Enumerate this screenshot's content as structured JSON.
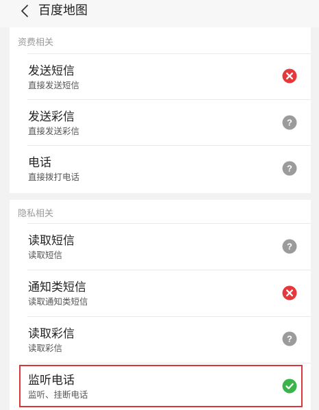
{
  "header": {
    "title": "百度地图"
  },
  "sections": [
    {
      "label": "资费相关",
      "items": [
        {
          "title": "发送短信",
          "subtitle": "直接发送短信",
          "status": "denied"
        },
        {
          "title": "发送彩信",
          "subtitle": "直接发送彩信",
          "status": "ask"
        },
        {
          "title": "电话",
          "subtitle": "直接拨打电话",
          "status": "ask"
        }
      ]
    },
    {
      "label": "隐私相关",
      "items": [
        {
          "title": "读取短信",
          "subtitle": "读取短信",
          "status": "ask"
        },
        {
          "title": "通知类短信",
          "subtitle": "读取通知类短信",
          "status": "denied"
        },
        {
          "title": "读取彩信",
          "subtitle": "读取彩信",
          "status": "ask"
        },
        {
          "title": "监听电话",
          "subtitle": "监听、挂断电话",
          "status": "allowed"
        }
      ]
    }
  ],
  "colors": {
    "denied": "#e5383b",
    "ask": "#9b9b9b",
    "allowed": "#3cb34a",
    "highlight": "#d9363a"
  },
  "icons": {
    "back": "chevron-left-icon",
    "denied": "close-circle-icon",
    "ask": "question-circle-icon",
    "allowed": "check-circle-icon"
  }
}
